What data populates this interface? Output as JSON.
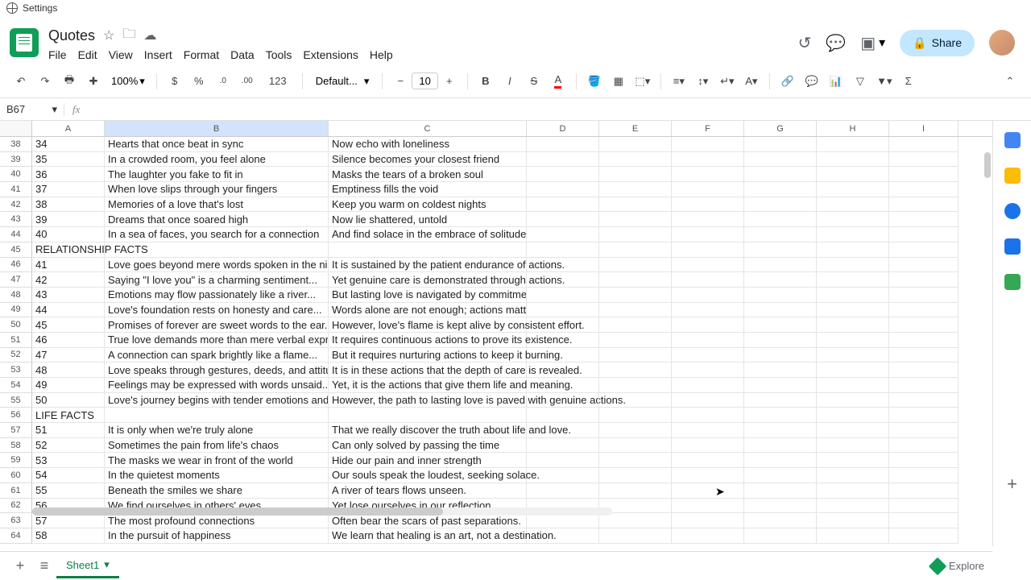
{
  "browser": {
    "tab_title": "Settings"
  },
  "doc": {
    "title": "Quotes"
  },
  "menus": {
    "file": "File",
    "edit": "Edit",
    "view": "View",
    "insert": "Insert",
    "format": "Format",
    "data": "Data",
    "tools": "Tools",
    "extensions": "Extensions",
    "help": "Help"
  },
  "header": {
    "share": "Share"
  },
  "toolbar": {
    "zoom": "100%",
    "currency": "$",
    "percent": "%",
    "dec_dec": ".0",
    "inc_dec": ".00",
    "num_fmt": "123",
    "font": "Default...",
    "font_size": "10"
  },
  "formula": {
    "namebox": "B67",
    "fx": "fx"
  },
  "columns": [
    "A",
    "B",
    "C",
    "D",
    "E",
    "F",
    "G",
    "H",
    "I"
  ],
  "colwidths": {
    "A": 90,
    "B": 278,
    "C": 246,
    "D": 90,
    "E": 90,
    "F": 90,
    "G": 90,
    "H": 90,
    "I": 86
  },
  "selected_col": "B",
  "rows": [
    {
      "n": 38,
      "a": "34",
      "b": "Hearts that once beat in sync",
      "c": "Now echo with loneliness"
    },
    {
      "n": 39,
      "a": "35",
      "b": "In a crowded room, you feel alone",
      "c": "Silence becomes your closest friend"
    },
    {
      "n": 40,
      "a": "36",
      "b": "The laughter you fake to fit in",
      "c": "Masks the tears of a broken soul"
    },
    {
      "n": 41,
      "a": "37",
      "b": "When love slips through your fingers",
      "c": "Emptiness fills the void"
    },
    {
      "n": 42,
      "a": "38",
      "b": "Memories of a love that's lost",
      "c": "Keep you warm on coldest nights"
    },
    {
      "n": 43,
      "a": "39",
      "b": "Dreams that once soared high",
      "c": "Now lie shattered, untold"
    },
    {
      "n": 44,
      "a": "40",
      "b": "In a sea of faces, you search for a connection",
      "c": "And find solace in the embrace of solitude"
    },
    {
      "n": 45,
      "a": "RELATIONSHIP FACTS",
      "b": "",
      "c": "",
      "span": true
    },
    {
      "n": 46,
      "a": "41",
      "b": "Love goes beyond mere words spoken in the night...",
      "c": "It is sustained by the patient endurance of actions.",
      "of": true
    },
    {
      "n": 47,
      "a": "42",
      "b": "Saying \"I love you\" is a charming sentiment...",
      "c": "Yet genuine care is demonstrated through actions.",
      "of": true
    },
    {
      "n": 48,
      "a": "43",
      "b": "Emotions may flow passionately like a river...",
      "c": "But lasting love is navigated by commitment."
    },
    {
      "n": 49,
      "a": "44",
      "b": "Love's foundation rests on honesty and care...",
      "c": "Words alone are not enough; actions matter."
    },
    {
      "n": 50,
      "a": "45",
      "b": "Promises of forever are sweet words to the ear...",
      "c": "However, love's flame is kept alive by consistent effort.",
      "of": true
    },
    {
      "n": 51,
      "a": "46",
      "b": "True love demands more than mere verbal expressio",
      "c": "It requires continuous actions to prove its existence.",
      "of": true
    },
    {
      "n": 52,
      "a": "47",
      "b": "A connection can spark brightly like a flame...",
      "c": "But it requires nurturing actions to keep it burning.",
      "of": true
    },
    {
      "n": 53,
      "a": "48",
      "b": "Love speaks through gestures, deeds, and attitudes.",
      "c": "It is in these actions that the depth of care is revealed.",
      "of": true
    },
    {
      "n": 54,
      "a": "49",
      "b": "Feelings may be expressed with words unsaid...",
      "c": "Yet, it is the actions that give them life and meaning.",
      "of": true
    },
    {
      "n": 55,
      "a": "50",
      "b": "Love's journey begins with tender emotions and exci",
      "c": "However, the path to lasting love is paved with genuine actions.",
      "of": true
    },
    {
      "n": 56,
      "a": "LIFE FACTS",
      "b": "",
      "c": "",
      "span": true
    },
    {
      "n": 57,
      "a": "51",
      "b": "It is only when we're truly alone",
      "c": "That we really discover the truth about life and love.",
      "of": true
    },
    {
      "n": 58,
      "a": "52",
      "b": "Sometimes the pain from life's chaos",
      "c": "Can only solved by passing the time"
    },
    {
      "n": 59,
      "a": "53",
      "b": "The masks we wear in front of the world",
      "c": "Hide our pain and inner strength"
    },
    {
      "n": 60,
      "a": "54",
      "b": "In the quietest moments",
      "c": "Our souls speak the loudest, seeking solace.",
      "of": true
    },
    {
      "n": 61,
      "a": "55",
      "b": "Beneath the smiles we share",
      "c": "A river of tears flows unseen."
    },
    {
      "n": 62,
      "a": "56",
      "b": "We find ourselves in others' eyes",
      "c": "Yet lose ourselves in our reflection."
    },
    {
      "n": 63,
      "a": "57",
      "b": "The most profound connections",
      "c": "Often bear the scars of past separations."
    },
    {
      "n": 64,
      "a": "58",
      "b": "In the pursuit of happiness",
      "c": "We learn that healing is an art, not a destination.",
      "of": true
    }
  ],
  "sheet": {
    "name": "Sheet1",
    "explore": "Explore"
  }
}
